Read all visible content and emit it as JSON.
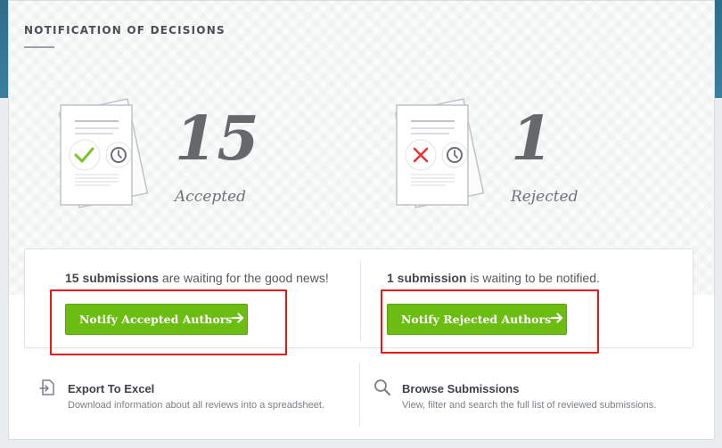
{
  "section": {
    "title": "NOTIFICATION OF DECISIONS"
  },
  "stats": {
    "accepted": {
      "count": "15",
      "label": "Accepted"
    },
    "rejected": {
      "count": "1",
      "label": "Rejected"
    }
  },
  "actions": {
    "accepted": {
      "count_text": "15 submissions",
      "rest_text": " are waiting for the good news!",
      "button_label": "Notify Accepted Authors"
    },
    "rejected": {
      "count_text": "1 submission",
      "rest_text": " is waiting to be notified.",
      "button_label": "Notify Rejected Authors"
    }
  },
  "footer": {
    "export": {
      "title": "Export To Excel",
      "description": "Download information about all reviews into a spreadsheet.",
      "icon": "export-file-icon"
    },
    "browse": {
      "title": "Browse Submissions",
      "description": "View, filter and search the full list of reviewed submissions.",
      "icon": "search-icon"
    }
  },
  "colors": {
    "header_band": "#3a7f9e",
    "button_green": "#6cbd12",
    "check_green": "#7cc22a",
    "reject_red": "#e8333a",
    "highlight_red": "#e8161a"
  }
}
